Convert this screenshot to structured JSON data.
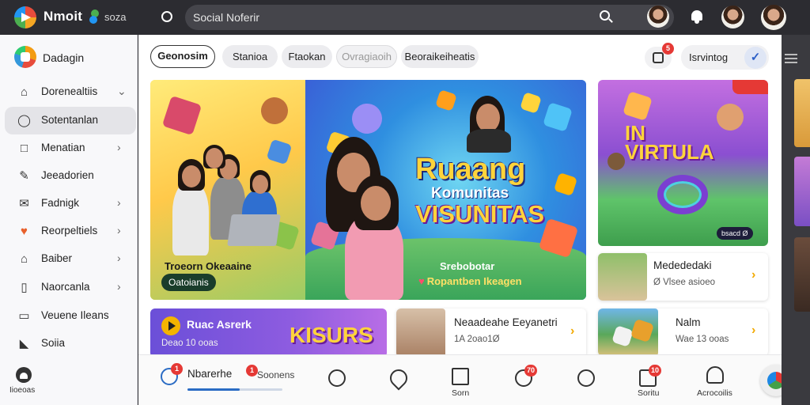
{
  "topbar": {
    "app_name": "Nmoit",
    "app_sub": "soza",
    "search_placeholder": "Social Noferir"
  },
  "sidebar": {
    "title": "Dadagin",
    "items": [
      {
        "label": "Dorenealtiis",
        "icon": "home-icon",
        "chevron": "⌄",
        "active": false
      },
      {
        "label": "Sotentanlan",
        "icon": "compass-icon",
        "chevron": "",
        "active": true
      },
      {
        "label": "Menatian",
        "icon": "square-icon",
        "chevron": "›",
        "active": false
      },
      {
        "label": "Jeeadorien",
        "icon": "pencil-icon",
        "chevron": "",
        "active": false
      },
      {
        "label": "Fadnigk",
        "icon": "mail-icon",
        "chevron": "›",
        "active": false
      },
      {
        "label": "Reorpeltiels",
        "icon": "heart-icon",
        "chevron": "›",
        "active": false
      },
      {
        "label": "Baiber",
        "icon": "bookmark-icon",
        "chevron": "›",
        "active": false
      },
      {
        "label": "Naorcanla",
        "icon": "file-icon",
        "chevron": "›",
        "active": false
      },
      {
        "label": "Veuene Ileans",
        "icon": "inbox-icon",
        "chevron": "",
        "active": false
      },
      {
        "label": "Soiia",
        "icon": "megaphone-icon",
        "chevron": "",
        "active": false
      }
    ],
    "bottom_label": "Iioeoas"
  },
  "filters": {
    "chips": [
      "Geonosim",
      "Stanioa",
      "Ftaokan",
      "Ovragiaoih",
      "Beoraikeiheatis"
    ],
    "active_index": 0,
    "dim_index": 3,
    "filter_badge": "5",
    "sort_label": "Isrvintog"
  },
  "hero": {
    "title_line1": "Ruaang",
    "title_line2": "Komunitas",
    "title_line3": "VISUNITAS",
    "caption": "Troeorn Okeaaine",
    "button_label": "Oatoianis",
    "sub1": "Srebobotar",
    "sub2": "Ropantben Ikeagen"
  },
  "promo": {
    "title_line1": "IN",
    "title_line2": "VIRTULA",
    "pill": "bsacd Ø"
  },
  "side_cards": [
    {
      "title": "Medededaki",
      "meta": "Ø Vlsee asioeo"
    },
    {
      "title": "Nalm",
      "meta": "Wae 13 ooas"
    }
  ],
  "bottom_cards": [
    {
      "title": "Ruac Asrerk",
      "meta": "Deao 10 ooas",
      "art_text": "KISURS"
    },
    {
      "title": "Neaadeahe Eeyanetri",
      "meta": "1A 2oao1Ø"
    }
  ],
  "bottom_nav": {
    "items": [
      {
        "label": "Nbarerhe",
        "icon": "clock-icon",
        "badge": "1",
        "sub": "Soonens"
      },
      {
        "label": "",
        "icon": "alert-icon",
        "badge": ""
      },
      {
        "label": "",
        "icon": "pin-icon",
        "badge": ""
      },
      {
        "label": "Sorn",
        "icon": "frame-icon",
        "badge": ""
      },
      {
        "label": "",
        "icon": "heart-icon",
        "badge": "70"
      },
      {
        "label": "",
        "icon": "face-icon",
        "badge": ""
      },
      {
        "label": "Soritu",
        "icon": "gift-icon",
        "badge": "10"
      },
      {
        "label": "Acrocoilis",
        "icon": "person-icon",
        "badge": ""
      }
    ],
    "progress": 0.55
  },
  "colors": {
    "topbar_bg": "#2c2c31",
    "accent": "#2c5fc7",
    "badge_red": "#e53935",
    "hero_title": "#ffd43b"
  }
}
